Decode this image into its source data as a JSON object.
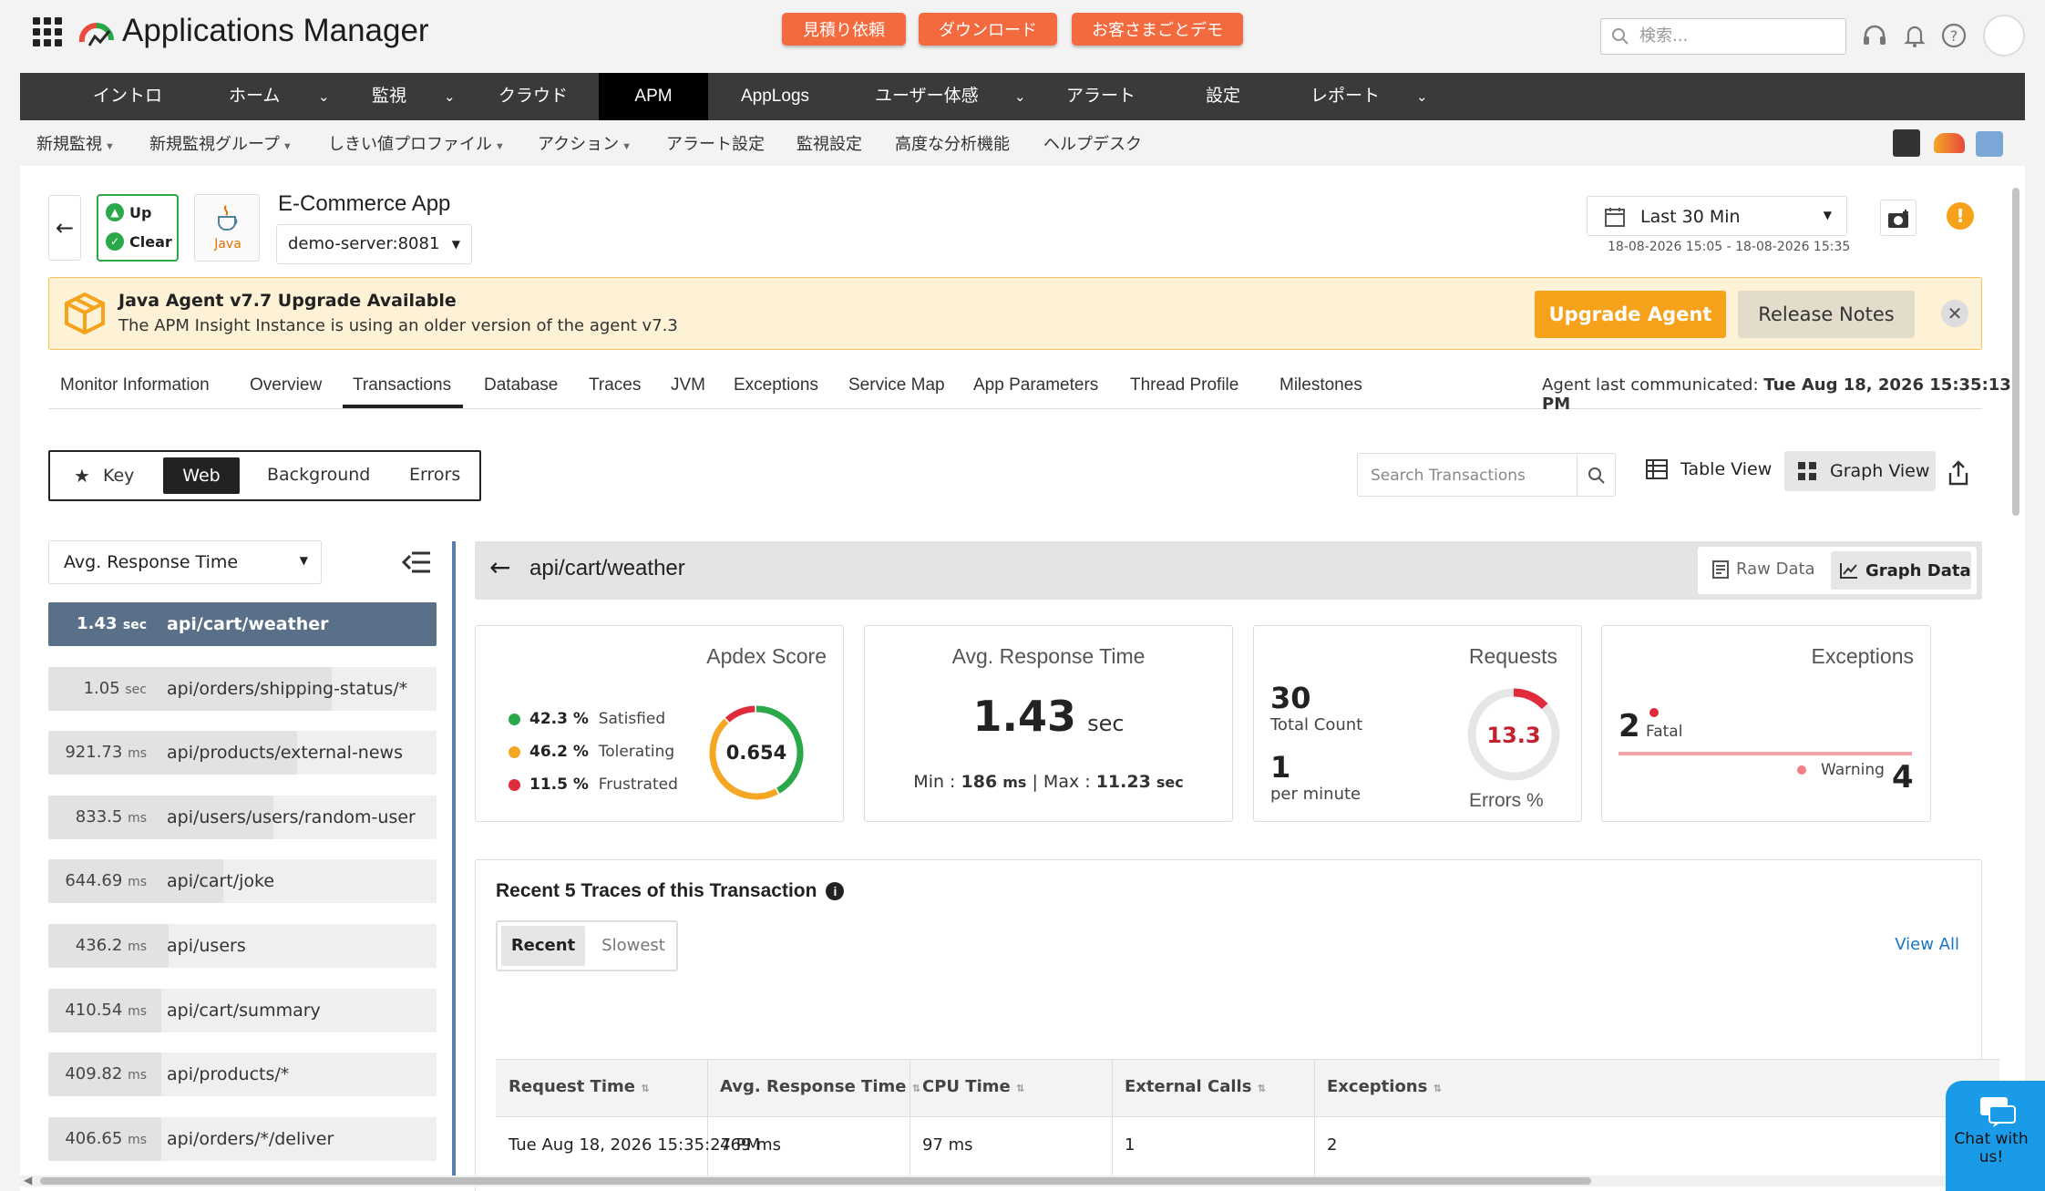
{
  "app": {
    "title": "Applications Manager"
  },
  "promos": [
    "見積り依頼",
    "ダウンロード",
    "お客さまごとデモ"
  ],
  "search": {
    "placeholder": "検索..."
  },
  "main_nav": [
    "イントロ",
    "ホーム",
    "監視",
    "クラウド",
    "APM",
    "AppLogs",
    "ユーザー体感",
    "アラート",
    "設定",
    "レポート"
  ],
  "sub_nav": [
    "新規監視",
    "新規監視グループ",
    "しきい値プロファイル",
    "アクション",
    "アラート設定",
    "監視設定",
    "高度な分析機能",
    "ヘルプデスク"
  ],
  "monitor": {
    "status_up": "Up",
    "status_clear": "Clear",
    "java_label": "Java",
    "name": "E-Commerce App",
    "server": "demo-server:8081",
    "time_range": "Last 30 Min",
    "time_window": "18-08-2026 15:05 - 18-08-2026 15:35"
  },
  "banner": {
    "title": "Java Agent v7.7 Upgrade Available",
    "text": "The APM Insight Instance is using an older version of the agent v7.3",
    "upgrade_label": "Upgrade Agent",
    "notes_label": "Release Notes"
  },
  "tabs": [
    "Monitor Information",
    "Overview",
    "Transactions",
    "Database",
    "Traces",
    "JVM",
    "Exceptions",
    "Service Map",
    "App Parameters",
    "Thread Profile",
    "Milestones"
  ],
  "agent": {
    "label": "Agent last communicated: ",
    "value": "Tue Aug 18, 2026 15:35:13 PM"
  },
  "filters": {
    "key": "Key",
    "web": "Web",
    "background": "Background",
    "errors": "Errors"
  },
  "tx_search": {
    "placeholder": "Search Transactions"
  },
  "views": {
    "table": "Table View",
    "graph": "Graph View"
  },
  "metric_select": "Avg. Response Time",
  "transactions": [
    {
      "value": "1.43",
      "unit": "sec",
      "name": "api/cart/weather",
      "fill": 1.0
    },
    {
      "value": "1.05",
      "unit": "sec",
      "name": "api/orders/shipping-status/*",
      "fill": 0.73
    },
    {
      "value": "921.73",
      "unit": "ms",
      "name": "api/products/external-news",
      "fill": 0.64
    },
    {
      "value": "833.5",
      "unit": "ms",
      "name": "api/users/users/random-user",
      "fill": 0.58
    },
    {
      "value": "644.69",
      "unit": "ms",
      "name": "api/cart/joke",
      "fill": 0.45
    },
    {
      "value": "436.2",
      "unit": "ms",
      "name": "api/users",
      "fill": 0.31
    },
    {
      "value": "410.54",
      "unit": "ms",
      "name": "api/cart/summary",
      "fill": 0.29
    },
    {
      "value": "409.82",
      "unit": "ms",
      "name": "api/products/*",
      "fill": 0.29
    },
    {
      "value": "406.65",
      "unit": "ms",
      "name": "api/orders/*/deliver",
      "fill": 0.29
    }
  ],
  "detail": {
    "title": "api/cart/weather",
    "raw_label": "Raw Data",
    "graph_label": "Graph Data",
    "apdex": {
      "title": "Apdex Score",
      "score": "0.654",
      "satisfied_pct": "42.3 %",
      "satisfied": "Satisfied",
      "tolerating_pct": "46.2 %",
      "tolerating": "Tolerating",
      "frustrated_pct": "11.5 %",
      "frustrated": "Frustrated",
      "segments": [
        42.3,
        46.2,
        11.5
      ]
    },
    "art": {
      "title": "Avg. Response Time",
      "value": "1.43",
      "unit": "sec",
      "min_label": "Min : ",
      "min": "186",
      "min_unit": "ms",
      "sep": "|",
      "max_label": "Max : ",
      "max": "11.23",
      "max_unit": "sec"
    },
    "requests": {
      "title": "Requests",
      "total": "30",
      "total_label": "Total Count",
      "per_min": "1",
      "per_min_label": "per minute",
      "errors_pct": "13.3",
      "errors_label": "Errors %"
    },
    "exceptions": {
      "title": "Exceptions",
      "fatal": "2",
      "fatal_label": "Fatal",
      "warning": "4",
      "warning_label": "Warning"
    }
  },
  "traces": {
    "title": "Recent 5 Traces of this Transaction",
    "recent": "Recent",
    "slowest": "Slowest",
    "view_all": "View All",
    "headers": [
      "Request Time",
      "Avg. Response Time",
      "CPU Time",
      "External Calls",
      "Exceptions"
    ],
    "rows": [
      [
        "Tue Aug 18, 2026 15:35:27 PM",
        "469 ms",
        "97 ms",
        "1",
        "2"
      ]
    ]
  },
  "chat": {
    "label": "Chat with us!"
  },
  "colors": {
    "green": "#2aa84a",
    "orange": "#f5a623",
    "red": "#e02b3c",
    "accent": "#f7a21b"
  }
}
